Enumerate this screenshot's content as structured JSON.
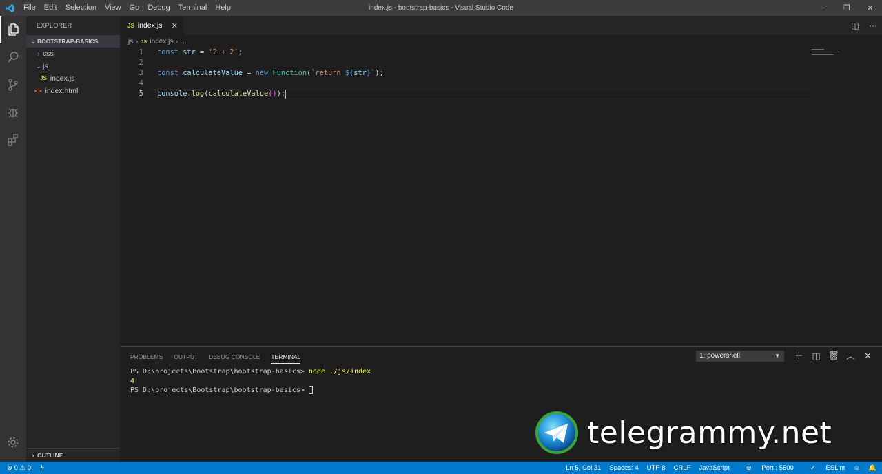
{
  "window": {
    "title": "index.js - bootstrap-basics - Visual Studio Code",
    "menu": [
      "File",
      "Edit",
      "Selection",
      "View",
      "Go",
      "Debug",
      "Terminal",
      "Help"
    ],
    "controls": {
      "minimize": "−",
      "maximize": "❐",
      "close": "✕"
    }
  },
  "activity_bar": {
    "icons": [
      "files-icon",
      "search-icon",
      "source-control-icon",
      "debug-icon",
      "extensions-icon"
    ],
    "bottom_icon": "gear-icon"
  },
  "sidebar": {
    "header": "EXPLORER",
    "section": "BOOTSTRAP-BASICS",
    "tree": [
      {
        "label": "css",
        "type": "folder",
        "expanded": false
      },
      {
        "label": "js",
        "type": "folder",
        "expanded": true
      },
      {
        "label": "index.js",
        "type": "js-file",
        "icon_text": "JS"
      },
      {
        "label": "index.html",
        "type": "html-file",
        "icon_text": "<>"
      }
    ],
    "outline": "OUTLINE"
  },
  "tabs": [
    {
      "label": "index.js",
      "icon_text": "JS",
      "active": true,
      "close": "✕"
    }
  ],
  "breadcrumb": {
    "folder": "js",
    "file": "index.js",
    "icon_text": "JS",
    "more": "..."
  },
  "editor": {
    "line_numbers": [
      "1",
      "2",
      "3",
      "4",
      "5"
    ],
    "current_line": 5,
    "lines": [
      {
        "tokens": [
          {
            "t": "const ",
            "c": "k"
          },
          {
            "t": "str",
            "c": "v"
          },
          {
            "t": " = ",
            "c": "p"
          },
          {
            "t": "'2 + 2'",
            "c": "s"
          },
          {
            "t": ";",
            "c": "p"
          }
        ]
      },
      {
        "tokens": []
      },
      {
        "tokens": [
          {
            "t": "const ",
            "c": "k"
          },
          {
            "t": "calculateValue",
            "c": "v"
          },
          {
            "t": " = ",
            "c": "p"
          },
          {
            "t": "new ",
            "c": "k"
          },
          {
            "t": "Function",
            "c": "t"
          },
          {
            "t": "(",
            "c": "p"
          },
          {
            "t": "`return ",
            "c": "s"
          },
          {
            "t": "${",
            "c": "k"
          },
          {
            "t": "str",
            "c": "v"
          },
          {
            "t": "}",
            "c": "k"
          },
          {
            "t": "`",
            "c": "s"
          },
          {
            "t": ");",
            "c": "p"
          }
        ]
      },
      {
        "tokens": []
      },
      {
        "tokens": [
          {
            "t": "console",
            "c": "v"
          },
          {
            "t": ".",
            "c": "p"
          },
          {
            "t": "log",
            "c": "f"
          },
          {
            "t": "(",
            "c": "p"
          },
          {
            "t": "calculateValue",
            "c": "f"
          },
          {
            "t": "()",
            "c": "b"
          },
          {
            "t": ");",
            "c": "p"
          }
        ]
      }
    ]
  },
  "panel": {
    "tabs": [
      "PROBLEMS",
      "OUTPUT",
      "DEBUG CONSOLE",
      "TERMINAL"
    ],
    "active_tab": "TERMINAL",
    "terminal_select": "1: powershell",
    "actions": [
      "plus-icon",
      "split-icon",
      "trash-icon",
      "chevron-up-icon",
      "close-icon"
    ],
    "terminal": {
      "prompt1": "PS D:\\projects\\Bootstrap\\bootstrap-basics> ",
      "command": "node ./js/index",
      "output": "4",
      "prompt2": "PS D:\\projects\\Bootstrap\\bootstrap-basics> "
    }
  },
  "watermark": {
    "text": "telegrammy.net"
  },
  "statusbar": {
    "errors": "0",
    "warnings": "0",
    "position": "Ln 5, Col 31",
    "spaces": "Spaces: 4",
    "encoding": "UTF-8",
    "eol": "CRLF",
    "language": "JavaScript",
    "port": "Port : 5500",
    "eslint": "ESLint"
  },
  "colors": {
    "accent": "#007acc",
    "titlebar": "#3c3c3c",
    "sidebar": "#252526",
    "editor": "#1e1e1e",
    "activity_bar": "#333333"
  }
}
